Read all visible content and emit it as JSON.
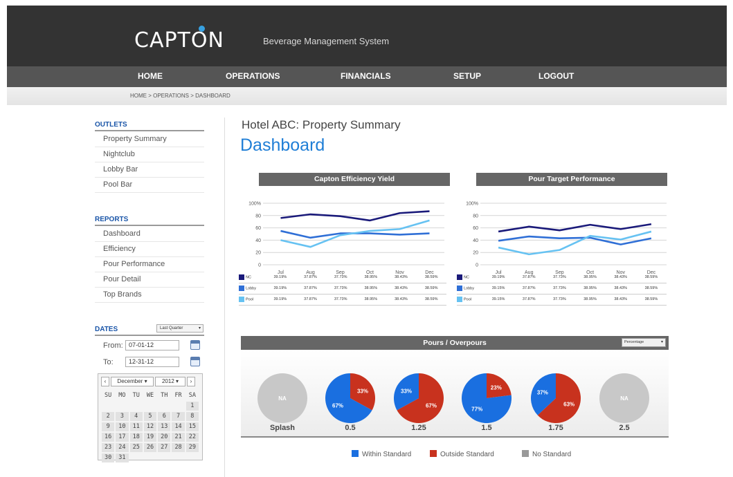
{
  "app": {
    "logo": "CAPTON",
    "tagline": "Beverage Management System"
  },
  "nav": {
    "items": [
      "HOME",
      "OPERATIONS",
      "FINANCIALS",
      "SETUP",
      "LOGOUT"
    ]
  },
  "breadcrumb": "HOME > OPERATIONS > DASHBOARD",
  "sidebar": {
    "outlets_title": "OUTLETS",
    "outlets": [
      "Property Summary",
      "Nightclub",
      "Lobby Bar",
      "Pool Bar"
    ],
    "reports_title": "REPORTS",
    "reports": [
      "Dashboard",
      "Efficiency",
      "Pour Performance",
      "Pour Detail",
      "Top Brands"
    ],
    "dates": {
      "title": "DATES",
      "range_select": "Last Quarter",
      "from_label": "From:",
      "from_value": "07-01-12",
      "to_label": "To:",
      "to_value": "12-31-12"
    },
    "calendar": {
      "prev": "‹",
      "next": "›",
      "month": "December",
      "year": "2012",
      "weekdays": [
        "SU",
        "MO",
        "TU",
        "WE",
        "TH",
        "FR",
        "SA"
      ],
      "leading_blanks": 6,
      "days": [
        "1",
        "2",
        "3",
        "4",
        "5",
        "6",
        "7",
        "8",
        "9",
        "10",
        "11",
        "12",
        "13",
        "14",
        "15",
        "16",
        "17",
        "18",
        "19",
        "20",
        "21",
        "22",
        "23",
        "24",
        "25",
        "26",
        "27",
        "28",
        "29",
        "30",
        "31"
      ]
    }
  },
  "main": {
    "property_title": "Hotel ABC: Property Summary",
    "page_title": "Dashboard"
  },
  "colors": {
    "nc": "#1a1a7a",
    "lobby": "#2f6fd6",
    "pool": "#66c2f2",
    "within": "#1a6fe0",
    "outside": "#c8321e",
    "none": "#c8c8c8"
  },
  "chart_data": [
    {
      "type": "line",
      "title": "Capton Efficiency Yield",
      "categories": [
        "Jul",
        "Aug",
        "Sep",
        "Oct",
        "Nov",
        "Dec"
      ],
      "y_ticks": [
        "100%",
        "80",
        "60",
        "40",
        "20",
        "0"
      ],
      "ylim": [
        0,
        100
      ],
      "grid": true,
      "series": [
        {
          "name": "NC",
          "values": [
            76,
            82,
            79,
            72,
            84,
            87
          ],
          "table": [
            "39.19%",
            "37.87%",
            "37.73%",
            "38.95%",
            "38.43%",
            "38.59%"
          ]
        },
        {
          "name": "Lobby",
          "values": [
            55,
            44,
            51,
            51,
            49,
            51
          ],
          "table": [
            "39.19%",
            "37.87%",
            "37.73%",
            "38.95%",
            "38.43%",
            "38.59%"
          ]
        },
        {
          "name": "Pool",
          "values": [
            40,
            29,
            48,
            55,
            58,
            72
          ],
          "table": [
            "39.19%",
            "37.87%",
            "37.73%",
            "38.95%",
            "38.43%",
            "38.59%"
          ]
        }
      ]
    },
    {
      "type": "line",
      "title": "Pour Target Performance",
      "categories": [
        "Jul",
        "Aug",
        "Sep",
        "Oct",
        "Nov",
        "Dec"
      ],
      "y_ticks": [
        "100%",
        "80",
        "60",
        "40",
        "20",
        "0"
      ],
      "ylim": [
        0,
        100
      ],
      "grid": true,
      "series": [
        {
          "name": "NC",
          "values": [
            54,
            62,
            56,
            65,
            58,
            66
          ],
          "table": [
            "39.19%",
            "37.87%",
            "37.73%",
            "38.95%",
            "38.43%",
            "38.59%"
          ]
        },
        {
          "name": "Lobby",
          "values": [
            39,
            46,
            43,
            44,
            33,
            43
          ],
          "table": [
            "39.15%",
            "37.87%",
            "37.73%",
            "38.95%",
            "38.43%",
            "38.59%"
          ]
        },
        {
          "name": "Pool",
          "values": [
            28,
            17,
            24,
            47,
            41,
            54
          ],
          "table": [
            "39.15%",
            "37.87%",
            "37.73%",
            "38.95%",
            "38.43%",
            "38.59%"
          ]
        }
      ]
    },
    {
      "type": "pie",
      "title": "Pours / Overpours",
      "selector": "Percentage",
      "legend": [
        "Within Standard",
        "Outside Standard",
        "No Standard"
      ],
      "pies": [
        {
          "label": "Splash",
          "within": null,
          "outside": null,
          "within_text": "",
          "outside_text": "",
          "na_text": "NA"
        },
        {
          "label": "0.5",
          "within": 67,
          "outside": 33,
          "within_text": "67%",
          "outside_text": "33%"
        },
        {
          "label": "1.25",
          "within": 33,
          "outside": 67,
          "within_text": "33%",
          "outside_text": "67%"
        },
        {
          "label": "1.5",
          "within": 77,
          "outside": 23,
          "within_text": "77%",
          "outside_text": "23%"
        },
        {
          "label": "1.75",
          "within": 37,
          "outside": 63,
          "within_text": "37%",
          "outside_text": "63%"
        },
        {
          "label": "2.5",
          "within": null,
          "outside": null,
          "within_text": "",
          "outside_text": "",
          "na_text": "NA"
        }
      ]
    }
  ]
}
